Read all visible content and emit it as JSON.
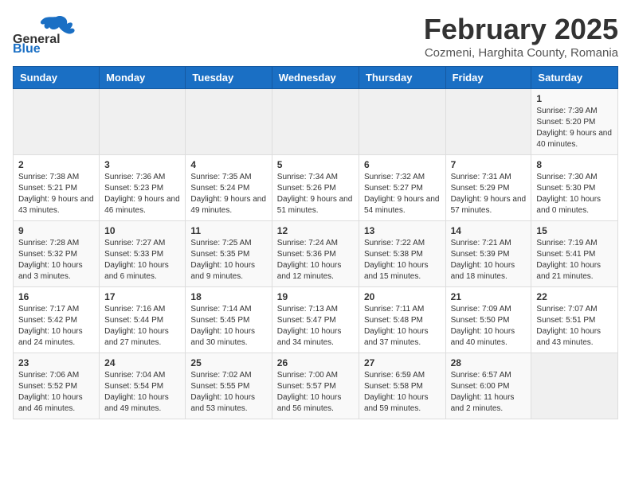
{
  "logo": {
    "line1": "General",
    "line2": "Blue"
  },
  "title": {
    "month_year": "February 2025",
    "location": "Cozmeni, Harghita County, Romania"
  },
  "weekdays": [
    "Sunday",
    "Monday",
    "Tuesday",
    "Wednesday",
    "Thursday",
    "Friday",
    "Saturday"
  ],
  "weeks": [
    [
      {
        "day": "",
        "info": ""
      },
      {
        "day": "",
        "info": ""
      },
      {
        "day": "",
        "info": ""
      },
      {
        "day": "",
        "info": ""
      },
      {
        "day": "",
        "info": ""
      },
      {
        "day": "",
        "info": ""
      },
      {
        "day": "1",
        "info": "Sunrise: 7:39 AM\nSunset: 5:20 PM\nDaylight: 9 hours and 40 minutes."
      }
    ],
    [
      {
        "day": "2",
        "info": "Sunrise: 7:38 AM\nSunset: 5:21 PM\nDaylight: 9 hours and 43 minutes."
      },
      {
        "day": "3",
        "info": "Sunrise: 7:36 AM\nSunset: 5:23 PM\nDaylight: 9 hours and 46 minutes."
      },
      {
        "day": "4",
        "info": "Sunrise: 7:35 AM\nSunset: 5:24 PM\nDaylight: 9 hours and 49 minutes."
      },
      {
        "day": "5",
        "info": "Sunrise: 7:34 AM\nSunset: 5:26 PM\nDaylight: 9 hours and 51 minutes."
      },
      {
        "day": "6",
        "info": "Sunrise: 7:32 AM\nSunset: 5:27 PM\nDaylight: 9 hours and 54 minutes."
      },
      {
        "day": "7",
        "info": "Sunrise: 7:31 AM\nSunset: 5:29 PM\nDaylight: 9 hours and 57 minutes."
      },
      {
        "day": "8",
        "info": "Sunrise: 7:30 AM\nSunset: 5:30 PM\nDaylight: 10 hours and 0 minutes."
      }
    ],
    [
      {
        "day": "9",
        "info": "Sunrise: 7:28 AM\nSunset: 5:32 PM\nDaylight: 10 hours and 3 minutes."
      },
      {
        "day": "10",
        "info": "Sunrise: 7:27 AM\nSunset: 5:33 PM\nDaylight: 10 hours and 6 minutes."
      },
      {
        "day": "11",
        "info": "Sunrise: 7:25 AM\nSunset: 5:35 PM\nDaylight: 10 hours and 9 minutes."
      },
      {
        "day": "12",
        "info": "Sunrise: 7:24 AM\nSunset: 5:36 PM\nDaylight: 10 hours and 12 minutes."
      },
      {
        "day": "13",
        "info": "Sunrise: 7:22 AM\nSunset: 5:38 PM\nDaylight: 10 hours and 15 minutes."
      },
      {
        "day": "14",
        "info": "Sunrise: 7:21 AM\nSunset: 5:39 PM\nDaylight: 10 hours and 18 minutes."
      },
      {
        "day": "15",
        "info": "Sunrise: 7:19 AM\nSunset: 5:41 PM\nDaylight: 10 hours and 21 minutes."
      }
    ],
    [
      {
        "day": "16",
        "info": "Sunrise: 7:17 AM\nSunset: 5:42 PM\nDaylight: 10 hours and 24 minutes."
      },
      {
        "day": "17",
        "info": "Sunrise: 7:16 AM\nSunset: 5:44 PM\nDaylight: 10 hours and 27 minutes."
      },
      {
        "day": "18",
        "info": "Sunrise: 7:14 AM\nSunset: 5:45 PM\nDaylight: 10 hours and 30 minutes."
      },
      {
        "day": "19",
        "info": "Sunrise: 7:13 AM\nSunset: 5:47 PM\nDaylight: 10 hours and 34 minutes."
      },
      {
        "day": "20",
        "info": "Sunrise: 7:11 AM\nSunset: 5:48 PM\nDaylight: 10 hours and 37 minutes."
      },
      {
        "day": "21",
        "info": "Sunrise: 7:09 AM\nSunset: 5:50 PM\nDaylight: 10 hours and 40 minutes."
      },
      {
        "day": "22",
        "info": "Sunrise: 7:07 AM\nSunset: 5:51 PM\nDaylight: 10 hours and 43 minutes."
      }
    ],
    [
      {
        "day": "23",
        "info": "Sunrise: 7:06 AM\nSunset: 5:52 PM\nDaylight: 10 hours and 46 minutes."
      },
      {
        "day": "24",
        "info": "Sunrise: 7:04 AM\nSunset: 5:54 PM\nDaylight: 10 hours and 49 minutes."
      },
      {
        "day": "25",
        "info": "Sunrise: 7:02 AM\nSunset: 5:55 PM\nDaylight: 10 hours and 53 minutes."
      },
      {
        "day": "26",
        "info": "Sunrise: 7:00 AM\nSunset: 5:57 PM\nDaylight: 10 hours and 56 minutes."
      },
      {
        "day": "27",
        "info": "Sunrise: 6:59 AM\nSunset: 5:58 PM\nDaylight: 10 hours and 59 minutes."
      },
      {
        "day": "28",
        "info": "Sunrise: 6:57 AM\nSunset: 6:00 PM\nDaylight: 11 hours and 2 minutes."
      },
      {
        "day": "",
        "info": ""
      }
    ]
  ]
}
